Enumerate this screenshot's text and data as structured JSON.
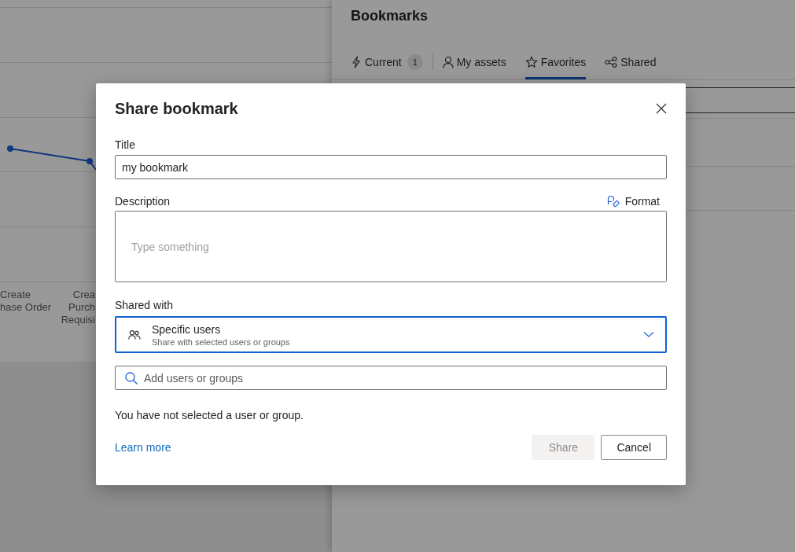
{
  "background_chart": {
    "axis_labels": [
      {
        "lines": [
          "Create",
          "hase Order"
        ]
      },
      {
        "lines": [
          "Crea",
          "Purch",
          "Requisi"
        ]
      }
    ]
  },
  "bookmarks_panel": {
    "title": "Bookmarks",
    "tabs": [
      {
        "label": "Current",
        "badge": "1",
        "selected": false
      },
      {
        "label": "My assets",
        "selected": false
      },
      {
        "label": "Favorites",
        "selected": true
      },
      {
        "label": "Shared",
        "selected": false
      }
    ]
  },
  "dialog": {
    "title": "Share bookmark",
    "title_field": {
      "label": "Title",
      "value": "my bookmark"
    },
    "description_field": {
      "label": "Description",
      "format_button": "Format",
      "placeholder": "Type something"
    },
    "shared_with": {
      "label": "Shared with",
      "option": "Specific users",
      "option_hint": "Share with selected users or groups",
      "focused": true
    },
    "people_search": {
      "placeholder": "Add users or groups"
    },
    "message": "You have not selected a user or group.",
    "learn_more": "Learn more",
    "buttons": [
      {
        "label": "Share",
        "disabled": true
      },
      {
        "label": "Cancel",
        "disabled": false
      }
    ]
  }
}
